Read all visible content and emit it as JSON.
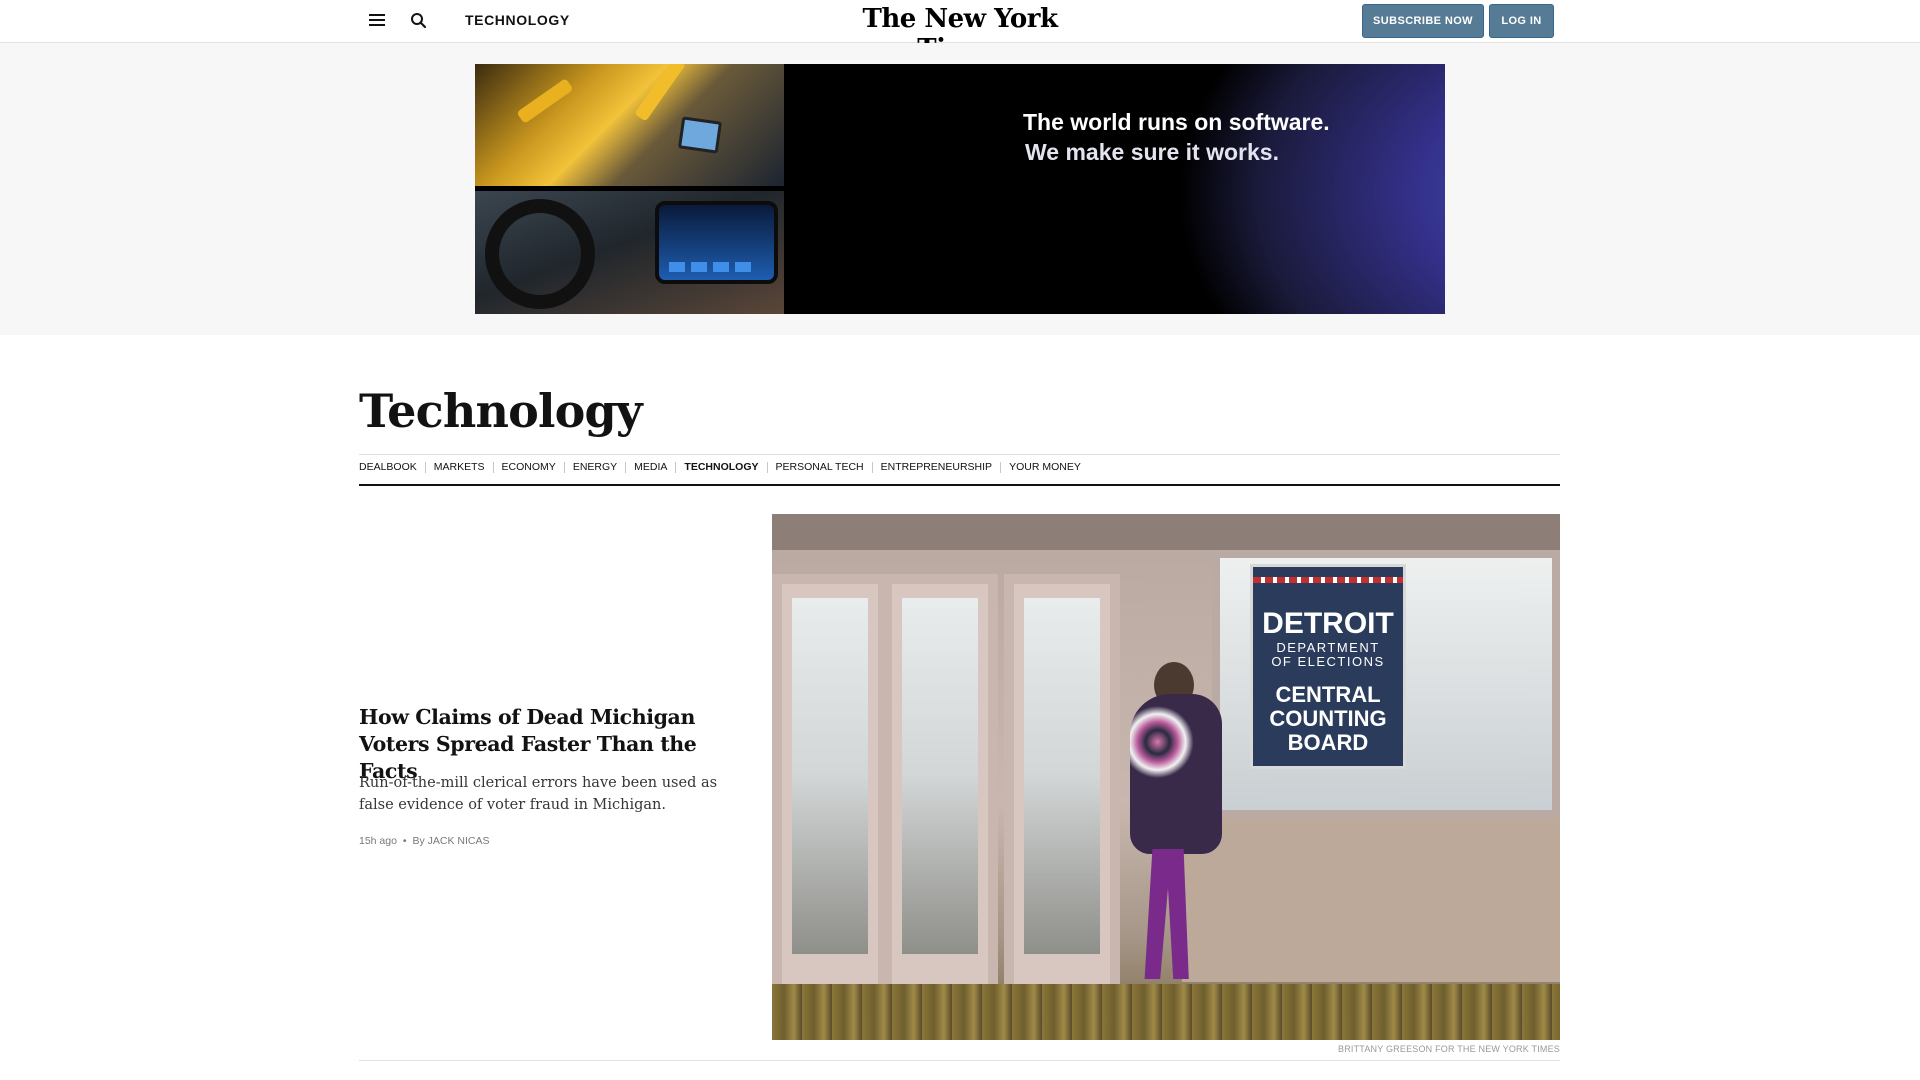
{
  "header": {
    "section_name": "TECHNOLOGY",
    "logo_text": "The New York Times",
    "subscribe_label": "SUBSCRIBE NOW",
    "login_label": "LOG IN",
    "menu_icon": "hamburger-menu-icon",
    "search_icon": "search-icon"
  },
  "ad": {
    "line1": "The world runs on software.",
    "line2": "We make sure it works."
  },
  "page": {
    "title": "Technology"
  },
  "subnav": {
    "items": [
      {
        "label": "DEALBOOK",
        "active": false
      },
      {
        "label": "MARKETS",
        "active": false
      },
      {
        "label": "ECONOMY",
        "active": false
      },
      {
        "label": "ENERGY",
        "active": false
      },
      {
        "label": "MEDIA",
        "active": false
      },
      {
        "label": "TECHNOLOGY",
        "active": true
      },
      {
        "label": "PERSONAL TECH",
        "active": false
      },
      {
        "label": "ENTREPRENEURSHIP",
        "active": false
      },
      {
        "label": "YOUR MONEY",
        "active": false
      }
    ]
  },
  "story": {
    "headline": "How Claims of Dead Michigan Voters Spread Faster Than the Facts",
    "summary": "Run-of-the-mill clerical errors have been used as false evidence of voter fraud in Michigan.",
    "time": "15h ago",
    "separator": "•",
    "byline": "By JACK NICAS",
    "photo_credit": "BRITTANY GREESON FOR THE NEW YORK TIMES",
    "photo_sign": {
      "line1": "DETROIT",
      "line2": "DEPARTMENT",
      "line3": "OF ELECTIONS",
      "line4": "CENTRAL",
      "line5": "COUNTING",
      "line6": "BOARD"
    }
  },
  "colors": {
    "button_bg": "#567b95",
    "text": "#121212",
    "ad_bg": "#f7f7f7"
  }
}
